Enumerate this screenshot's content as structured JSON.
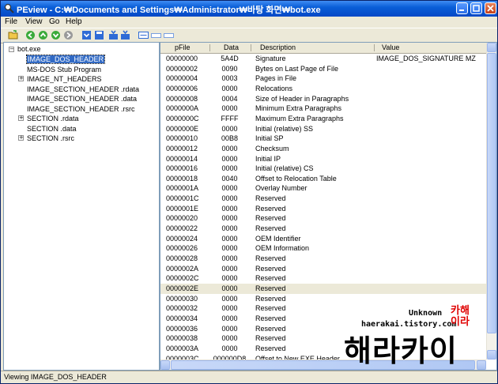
{
  "window": {
    "title": "PEview - C:₩Documents and Settings₩Administrator₩바탕 화면₩bot.exe"
  },
  "menu": [
    "File",
    "View",
    "Go",
    "Help"
  ],
  "tree": [
    {
      "label": "bot.exe",
      "expander": "-"
    },
    {
      "label": "IMAGE_DOS_HEADER",
      "selected": true
    },
    {
      "label": "MS-DOS Stub Program"
    },
    {
      "label": "IMAGE_NT_HEADERS",
      "expander": "+"
    },
    {
      "label": "IMAGE_SECTION_HEADER .rdata"
    },
    {
      "label": "IMAGE_SECTION_HEADER .data"
    },
    {
      "label": "IMAGE_SECTION_HEADER .rsrc"
    },
    {
      "label": "SECTION .rdata",
      "expander": "+"
    },
    {
      "label": "SECTION .data"
    },
    {
      "label": "SECTION .rsrc",
      "expander": "+"
    }
  ],
  "columns": [
    "pFile",
    "Data",
    "Description",
    "Value"
  ],
  "rows": [
    {
      "pfile": "00000000",
      "data": "5A4D",
      "desc": "Signature",
      "value": "IMAGE_DOS_SIGNATURE  MZ"
    },
    {
      "pfile": "00000002",
      "data": "0090",
      "desc": "Bytes on Last Page of File",
      "value": ""
    },
    {
      "pfile": "00000004",
      "data": "0003",
      "desc": "Pages in File",
      "value": ""
    },
    {
      "pfile": "00000006",
      "data": "0000",
      "desc": "Relocations",
      "value": ""
    },
    {
      "pfile": "00000008",
      "data": "0004",
      "desc": "Size of Header in Paragraphs",
      "value": ""
    },
    {
      "pfile": "0000000A",
      "data": "0000",
      "desc": "Minimum Extra Paragraphs",
      "value": ""
    },
    {
      "pfile": "0000000C",
      "data": "FFFF",
      "desc": "Maximum Extra Paragraphs",
      "value": ""
    },
    {
      "pfile": "0000000E",
      "data": "0000",
      "desc": "Initial (relative) SS",
      "value": ""
    },
    {
      "pfile": "00000010",
      "data": "00B8",
      "desc": "Initial SP",
      "value": ""
    },
    {
      "pfile": "00000012",
      "data": "0000",
      "desc": "Checksum",
      "value": ""
    },
    {
      "pfile": "00000014",
      "data": "0000",
      "desc": "Initial IP",
      "value": ""
    },
    {
      "pfile": "00000016",
      "data": "0000",
      "desc": "Initial (relative) CS",
      "value": ""
    },
    {
      "pfile": "00000018",
      "data": "0040",
      "desc": "Offset to Relocation Table",
      "value": ""
    },
    {
      "pfile": "0000001A",
      "data": "0000",
      "desc": "Overlay Number",
      "value": ""
    },
    {
      "pfile": "0000001C",
      "data": "0000",
      "desc": "Reserved",
      "value": ""
    },
    {
      "pfile": "0000001E",
      "data": "0000",
      "desc": "Reserved",
      "value": ""
    },
    {
      "pfile": "00000020",
      "data": "0000",
      "desc": "Reserved",
      "value": ""
    },
    {
      "pfile": "00000022",
      "data": "0000",
      "desc": "Reserved",
      "value": ""
    },
    {
      "pfile": "00000024",
      "data": "0000",
      "desc": "OEM Identifier",
      "value": ""
    },
    {
      "pfile": "00000026",
      "data": "0000",
      "desc": "OEM Information",
      "value": ""
    },
    {
      "pfile": "00000028",
      "data": "0000",
      "desc": "Reserved",
      "value": ""
    },
    {
      "pfile": "0000002A",
      "data": "0000",
      "desc": "Reserved",
      "value": ""
    },
    {
      "pfile": "0000002C",
      "data": "0000",
      "desc": "Reserved",
      "value": ""
    },
    {
      "pfile": "0000002E",
      "data": "0000",
      "desc": "Reserved",
      "value": "",
      "highlight": true
    },
    {
      "pfile": "00000030",
      "data": "0000",
      "desc": "Reserved",
      "value": ""
    },
    {
      "pfile": "00000032",
      "data": "0000",
      "desc": "Reserved",
      "value": ""
    },
    {
      "pfile": "00000034",
      "data": "0000",
      "desc": "Reserved",
      "value": ""
    },
    {
      "pfile": "00000036",
      "data": "0000",
      "desc": "Reserved",
      "value": ""
    },
    {
      "pfile": "00000038",
      "data": "0000",
      "desc": "Reserved",
      "value": ""
    },
    {
      "pfile": "0000003A",
      "data": "0000",
      "desc": "Reserved",
      "value": ""
    },
    {
      "pfile": "0000003C",
      "data": "000000D8",
      "desc": "Offset to New EXE Header",
      "value": ""
    }
  ],
  "status": "Viewing IMAGE_DOS_HEADER",
  "watermark": {
    "line1": "Unknown",
    "line2": "haerakai.tistory.com",
    "line3": "해라카이",
    "stamp": "카해이라"
  }
}
